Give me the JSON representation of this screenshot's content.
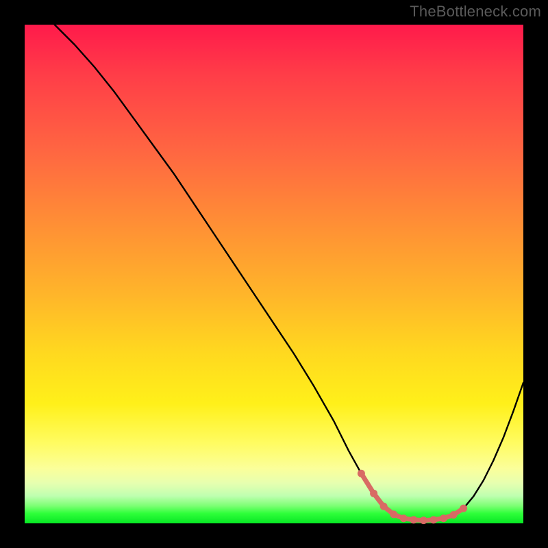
{
  "watermark": "TheBottleneck.com",
  "chart_data": {
    "type": "line",
    "title": "",
    "xlabel": "",
    "ylabel": "",
    "xlim": [
      0,
      100
    ],
    "ylim": [
      0,
      100
    ],
    "grid": false,
    "legend": false,
    "series": [
      {
        "name": "curve",
        "x": [
          6,
          10,
          14,
          18,
          22,
          26,
          30,
          34,
          38,
          42,
          46,
          50,
          54,
          58,
          62,
          65,
          67.5,
          70,
          72,
          74,
          76,
          78,
          80,
          82,
          84,
          86,
          88,
          90,
          92,
          94,
          96,
          98,
          100
        ],
        "y": [
          100,
          96,
          91.5,
          86.5,
          81,
          75.5,
          70,
          64,
          58,
          52,
          46,
          40,
          34,
          27.5,
          20.5,
          14.5,
          10,
          6,
          3.4,
          1.8,
          1.0,
          0.7,
          0.6,
          0.7,
          1.0,
          1.7,
          3.0,
          5.4,
          8.6,
          12.6,
          17.2,
          22.5,
          28.2
        ]
      }
    ],
    "highlight_dots": {
      "x": [
        67.5,
        70,
        72,
        74,
        76,
        78,
        80,
        82,
        84,
        86,
        88
      ],
      "y": [
        10,
        6,
        3.4,
        1.8,
        1.0,
        0.7,
        0.6,
        0.7,
        1.0,
        1.7,
        3.0
      ]
    },
    "colors": {
      "curve": "#000000",
      "highlight": "#d86a64",
      "gradient_top": "#ff1a4b",
      "gradient_bottom": "#07e824"
    }
  }
}
